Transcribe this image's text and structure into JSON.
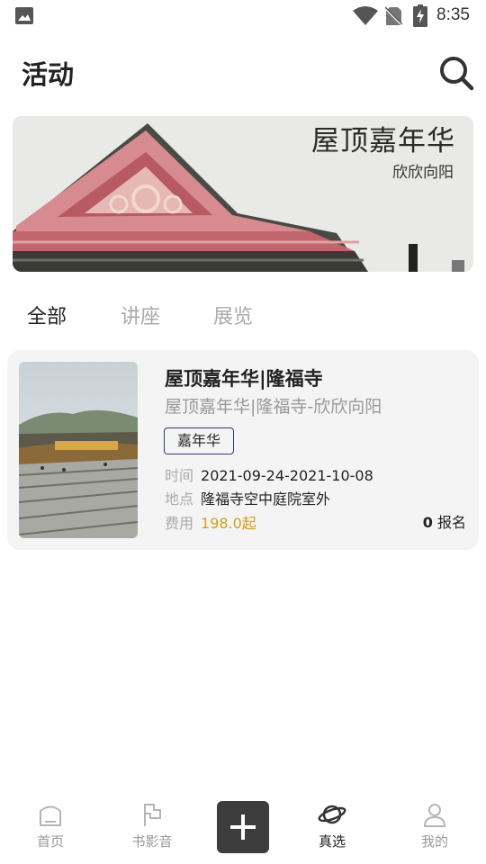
{
  "status_bar": {
    "time": "8:35",
    "icons": [
      "image-icon",
      "wifi-icon",
      "no-sim-icon",
      "battery-charging-icon"
    ]
  },
  "header": {
    "title": "活动",
    "search_icon": "search-icon"
  },
  "banner": {
    "title": "屋顶嘉年华",
    "subtitle": "欣欣向阳"
  },
  "tabs": [
    {
      "label": "全部",
      "active": true
    },
    {
      "label": "讲座",
      "active": false
    },
    {
      "label": "展览",
      "active": false
    }
  ],
  "events": [
    {
      "title": "屋顶嘉年华|隆福寺",
      "subtitle": "屋顶嘉年华|隆福寺-欣欣向阳",
      "tag": "嘉年华",
      "time_label": "时间",
      "time": "2021-09-24-2021-10-08",
      "place_label": "地点",
      "place": "隆福寺空中庭院室外",
      "fee_label": "费用",
      "fee": "198.0起",
      "signup_count": "0",
      "signup_label": "报名"
    }
  ],
  "bottom_nav": [
    {
      "label": "首页",
      "icon": "home-icon",
      "active": false
    },
    {
      "label": "书影音",
      "icon": "flag-icon",
      "active": false
    },
    {
      "label": "",
      "icon": "plus-icon",
      "active": false
    },
    {
      "label": "真选",
      "icon": "planet-icon",
      "active": true
    },
    {
      "label": "我的",
      "icon": "user-icon",
      "active": false
    }
  ],
  "colors": {
    "accent_price": "#d4a017",
    "tag_border": "#2b3a78",
    "card_bg": "#f4f4f4",
    "add_button_bg": "#3d3d3d"
  }
}
